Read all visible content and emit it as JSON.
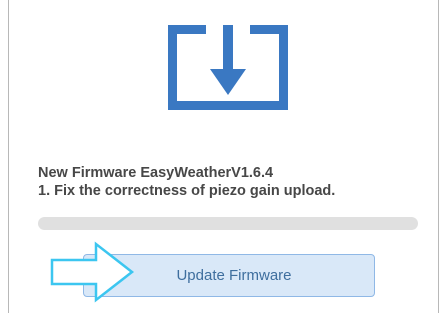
{
  "firmware": {
    "title": "New Firmware EasyWeatherV1.6.4",
    "note": "1. Fix the correctness of piezo gain upload."
  },
  "progress": {
    "value": 0
  },
  "update_button": {
    "label": "Update Firmware"
  },
  "icons": {
    "download": "download-icon",
    "pointer": "arrow-right-icon"
  },
  "colors": {
    "accent": "#3a78c2",
    "button_bg": "#d9e8f8",
    "button_border": "#8fb8e6",
    "pointer": "#3cc6f0"
  }
}
